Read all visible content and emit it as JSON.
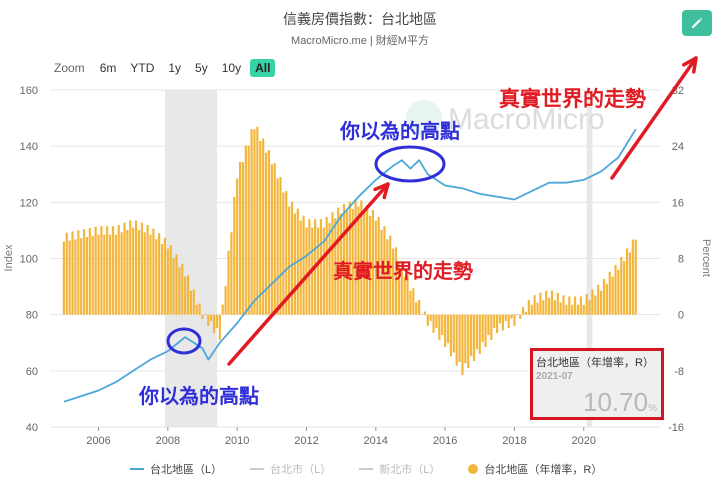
{
  "header": {
    "title": "信義房價指數：台北地區",
    "subtitle": "MacroMicro.me | 財經M平方"
  },
  "toolbar": {
    "zoom_label": "Zoom",
    "zoom_options": [
      "6m",
      "YTD",
      "1y",
      "5y",
      "10y",
      "All"
    ],
    "active_zoom": "All",
    "edit_icon": "pencil-icon"
  },
  "watermark": "MacroMicro",
  "annotations": {
    "peak_label_top": "你以為的高點",
    "peak_label_bottom": "你以為的高點",
    "trend_label_mid": "真實世界的走勢",
    "trend_label_top": "真實世界的走勢",
    "circle_color": "#2f2fd8",
    "arrow_color": "#e01b23"
  },
  "tooltip": {
    "series": "台北地區（年增率，R）",
    "date": "2021-07",
    "value": "10.70",
    "unit": "%"
  },
  "legend": [
    {
      "label": "台北地區（L）",
      "color": "#4aa8d8",
      "shape": "line",
      "enabled": true
    },
    {
      "label": "台北市（L）",
      "color": "#cccccc",
      "shape": "line",
      "enabled": false
    },
    {
      "label": "新北市（L）",
      "color": "#cccccc",
      "shape": "line",
      "enabled": false
    },
    {
      "label": "台北地區（年增率，R）",
      "color": "#f3b63c",
      "shape": "dot",
      "enabled": true
    }
  ],
  "chart_data": {
    "type": "line+bar",
    "xlabel": "",
    "ylabel_left": "Index",
    "ylabel_right": "Percent",
    "x_ticks": [
      "2006",
      "2008",
      "2010",
      "2012",
      "2014",
      "2016",
      "2018",
      "2020"
    ],
    "y_left_ticks": [
      40,
      60,
      80,
      100,
      120,
      140,
      160
    ],
    "y_right_ticks": [
      -16,
      -8,
      0,
      8,
      16,
      24,
      32
    ],
    "ylim_left": [
      40,
      160
    ],
    "ylim_right": [
      -16,
      32
    ],
    "grid": true,
    "shaded_periods": [
      [
        "2007-12",
        "2009-06"
      ],
      [
        "2020-02",
        "2020-04"
      ]
    ],
    "series": [
      {
        "name": "台北地區（L）",
        "axis": "left",
        "type": "line",
        "color": "#4aa8d8",
        "points": [
          [
            "2005-01",
            49
          ],
          [
            "2005-07",
            51
          ],
          [
            "2006-01",
            53
          ],
          [
            "2006-07",
            56
          ],
          [
            "2007-01",
            60
          ],
          [
            "2007-07",
            64
          ],
          [
            "2008-01",
            67
          ],
          [
            "2008-07",
            72
          ],
          [
            "2009-01",
            68
          ],
          [
            "2009-03",
            64
          ],
          [
            "2009-07",
            70
          ],
          [
            "2010-01",
            77
          ],
          [
            "2010-07",
            85
          ],
          [
            "2011-01",
            91
          ],
          [
            "2011-07",
            97
          ],
          [
            "2012-01",
            101
          ],
          [
            "2012-07",
            106
          ],
          [
            "2013-01",
            115
          ],
          [
            "2013-07",
            122
          ],
          [
            "2014-01",
            128
          ],
          [
            "2014-07",
            133
          ],
          [
            "2014-10",
            135
          ],
          [
            "2015-01",
            132
          ],
          [
            "2015-04",
            135
          ],
          [
            "2015-07",
            130
          ],
          [
            "2016-01",
            126
          ],
          [
            "2016-07",
            125
          ],
          [
            "2017-01",
            123
          ],
          [
            "2017-07",
            122
          ],
          [
            "2018-01",
            121
          ],
          [
            "2018-07",
            124
          ],
          [
            "2019-01",
            127
          ],
          [
            "2019-07",
            127
          ],
          [
            "2020-01",
            128
          ],
          [
            "2020-07",
            131
          ],
          [
            "2021-01",
            136
          ],
          [
            "2021-07",
            146
          ]
        ]
      },
      {
        "name": "台北地區（年增率，R）",
        "axis": "right",
        "type": "bar",
        "color": "#f3b63c",
        "points": [
          [
            "2005-01",
            11
          ],
          [
            "2005-07",
            11.5
          ],
          [
            "2006-01",
            12
          ],
          [
            "2006-07",
            12
          ],
          [
            "2007-01",
            13
          ],
          [
            "2007-07",
            12
          ],
          [
            "2008-01",
            10
          ],
          [
            "2008-07",
            6
          ],
          [
            "2009-01",
            0
          ],
          [
            "2009-07",
            -3
          ],
          [
            "2010-01",
            20
          ],
          [
            "2010-07",
            27
          ],
          [
            "2011-01",
            22
          ],
          [
            "2011-07",
            16
          ],
          [
            "2012-01",
            13
          ],
          [
            "2012-07",
            13
          ],
          [
            "2013-01",
            15
          ],
          [
            "2013-07",
            16
          ],
          [
            "2014-01",
            14
          ],
          [
            "2014-07",
            10
          ],
          [
            "2015-01",
            4
          ],
          [
            "2015-07",
            -1
          ],
          [
            "2016-01",
            -4
          ],
          [
            "2016-07",
            -8
          ],
          [
            "2017-01",
            -5
          ],
          [
            "2017-07",
            -2
          ],
          [
            "2018-01",
            -1
          ],
          [
            "2018-07",
            2
          ],
          [
            "2019-01",
            3
          ],
          [
            "2019-07",
            2
          ],
          [
            "2020-01",
            2
          ],
          [
            "2020-07",
            4
          ],
          [
            "2021-01",
            7
          ],
          [
            "2021-07",
            10.7
          ]
        ]
      }
    ]
  }
}
